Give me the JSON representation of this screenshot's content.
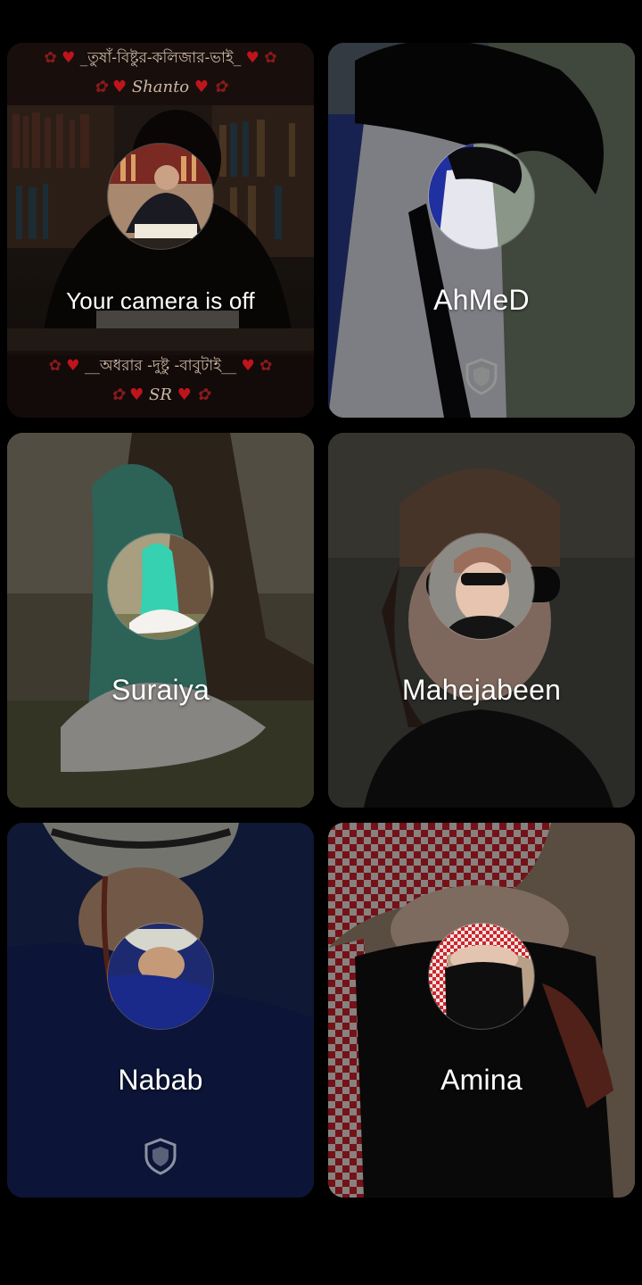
{
  "tiles": [
    {
      "name": "Your camera is off",
      "is_self": true,
      "banner": {
        "top_line": "_তুষাঁ-বিষ্টুর-কলিজার-ভাই_",
        "top_sub": "Shanto",
        "bottom_line": "__অধরার -দুষ্টু -বাবুটাই__",
        "bottom_sub": "SR"
      },
      "shield_icon": "none"
    },
    {
      "name": "AhMeD",
      "shield_icon": "shield-icon"
    },
    {
      "name": "Suraiya",
      "shield_icon": "none"
    },
    {
      "name": "Mahejabeen",
      "shield_icon": "none"
    },
    {
      "name": "Nabab",
      "shield_icon": "shield-icon"
    },
    {
      "name": "Amina",
      "shield_icon": "none"
    }
  ],
  "colors": {
    "page_background": "#000000",
    "name_text": "#ffffff",
    "heart": "#c0141c"
  }
}
